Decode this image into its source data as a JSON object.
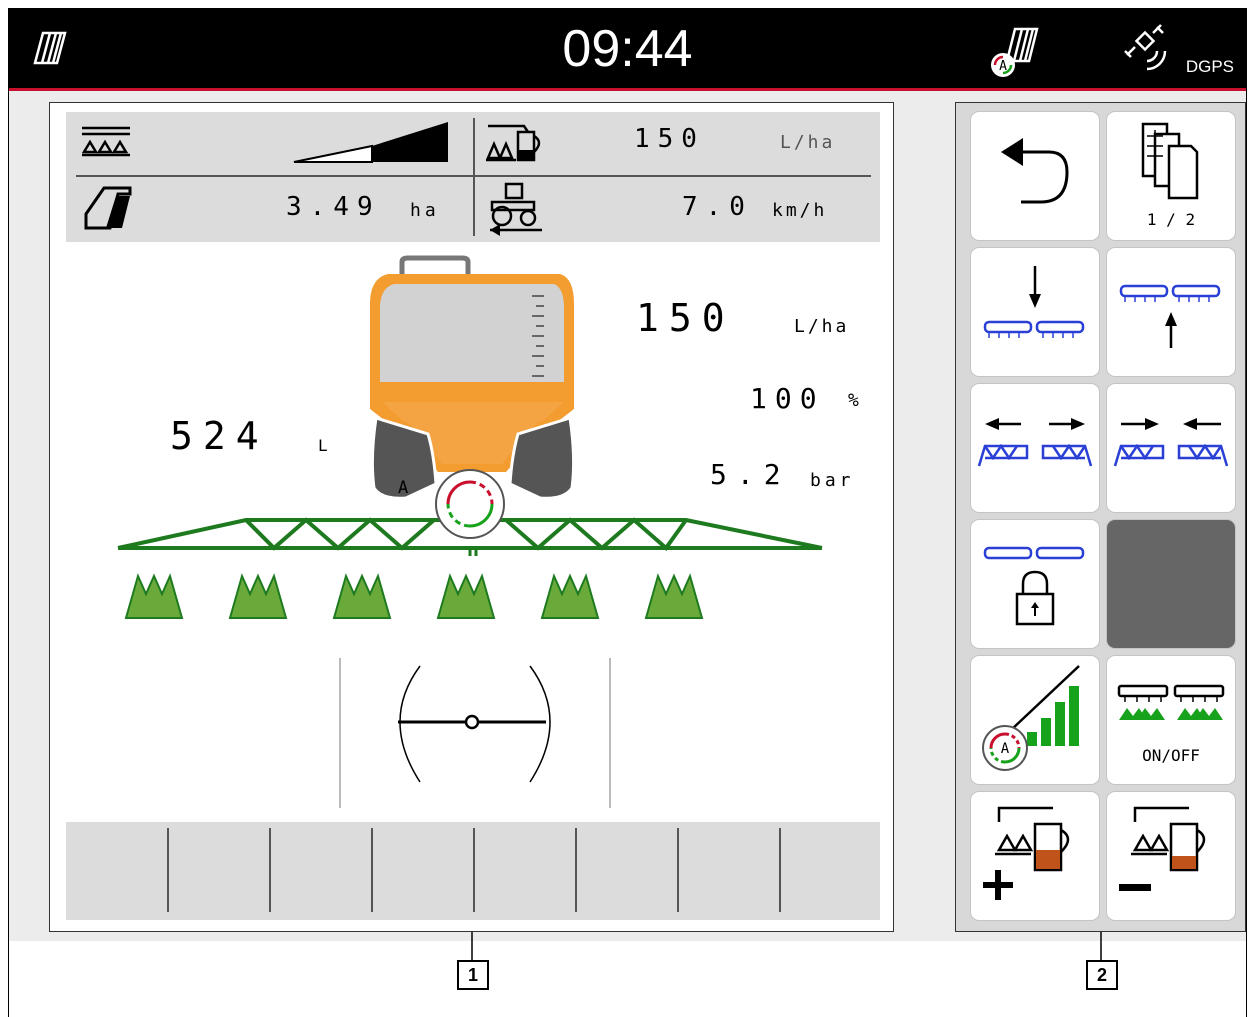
{
  "header": {
    "clock": "09:44",
    "left_icon": "implement-icon",
    "gps_label": "DGPS",
    "icons": [
      "auto-implement-icon",
      "satellite-icon"
    ]
  },
  "status_bar": {
    "application_rate_value": "150",
    "application_rate_unit": "L/ha",
    "area_value": "3.49",
    "area_unit": "ha",
    "speed_value": "7.0",
    "speed_unit": "km/h"
  },
  "work_display": {
    "rate_value": "150",
    "rate_unit": "L/ha",
    "percent_value": "100",
    "percent_unit": "%",
    "pressure_value": "5.2",
    "pressure_unit": "bar",
    "tank_value": "524",
    "tank_unit": "L",
    "auto_badge": "A",
    "tank_fill_fraction": 0.2
  },
  "menu": {
    "page_indicator": "1 / 2",
    "onoff_label": "ON/OFF",
    "buttons": [
      "back-button",
      "page-switch-button",
      "lower-boom-button",
      "raise-boom-button",
      "unfold-boom-button",
      "fold-boom-button",
      "boom-lock-button",
      "empty-slot",
      "auto-rate-button",
      "nozzles-on-off-button",
      "increase-rate-button",
      "decrease-rate-button"
    ]
  },
  "callouts": {
    "one": "1",
    "two": "2"
  },
  "colors": {
    "accent_red": "#c8102e",
    "tank_orange": "#f39c2f",
    "boom_green": "#1e7a1e",
    "crop_green": "#6aaa3a",
    "button_blue": "#2a3fd6",
    "auto_green": "#17a21b"
  }
}
